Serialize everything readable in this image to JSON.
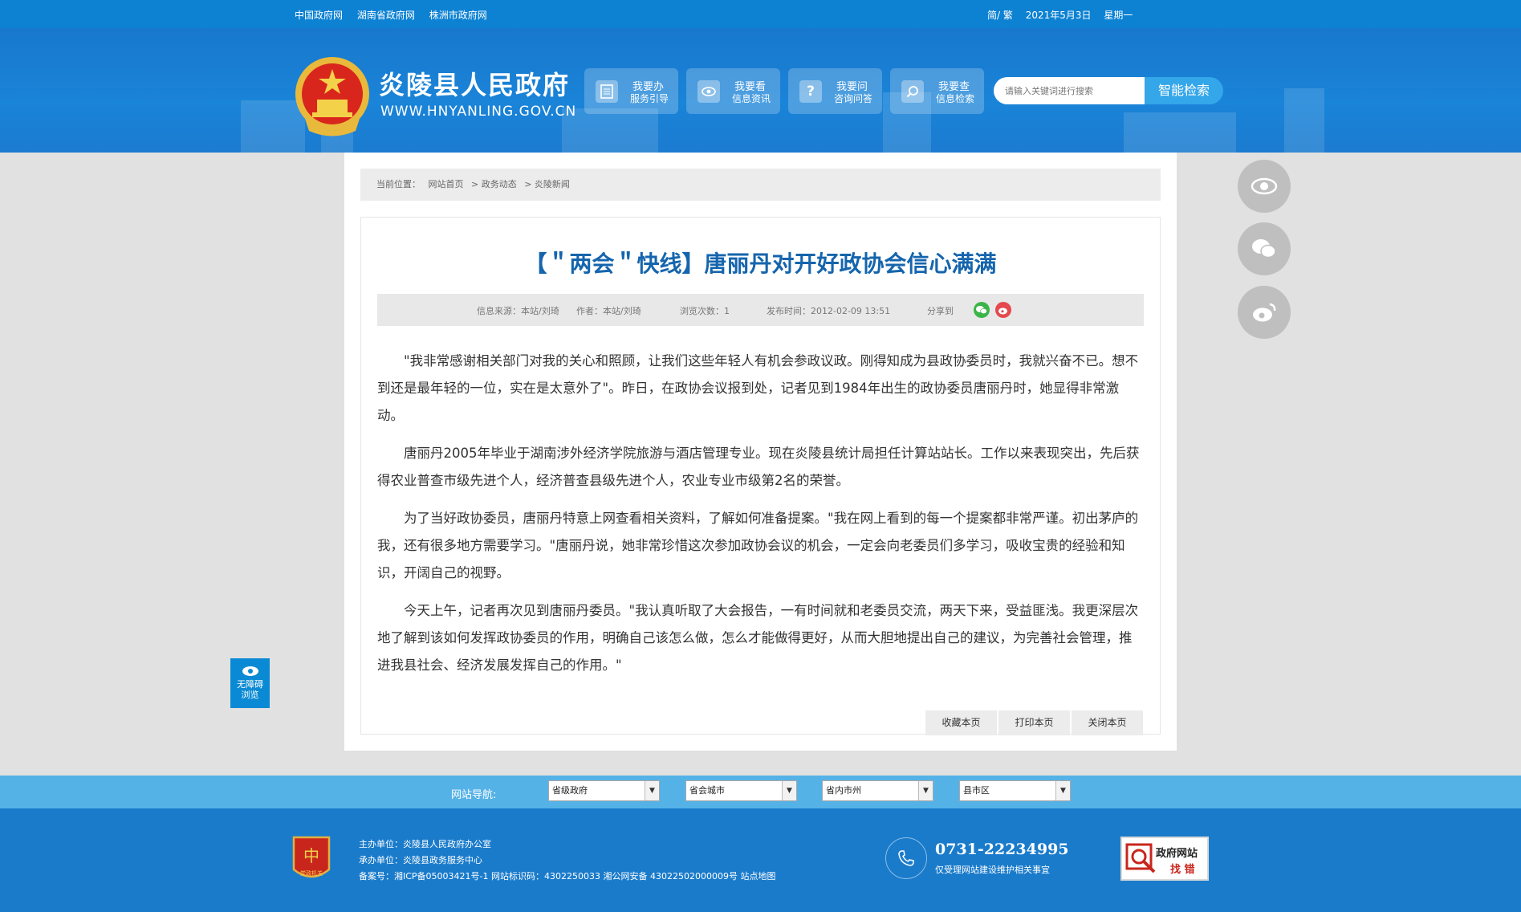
{
  "topbar": {
    "links": [
      "中国政府网",
      "湖南省政府网",
      "株洲市政府网"
    ],
    "lang": "简/ 繁",
    "date": "2021年5月3日",
    "weekday": "星期一"
  },
  "header": {
    "site_name": "炎陵县人民政府",
    "domain": "WWW.HNYANLING.GOV.CN",
    "quick_buttons": [
      {
        "line1": "我要办",
        "line2": "服务引导",
        "icon": "document-icon"
      },
      {
        "line1": "我要看",
        "line2": "信息资讯",
        "icon": "eye-icon"
      },
      {
        "line1": "我要问",
        "line2": "咨询问答",
        "icon": "question-icon"
      },
      {
        "line1": "我要查",
        "line2": "信息检索",
        "icon": "search-icon"
      }
    ],
    "search_placeholder": "请输入关键词进行搜索",
    "search_button": "智能检索"
  },
  "breadcrumb": {
    "prefix": "当前位置：",
    "items": [
      "网站首页",
      "> 政务动态",
      "> 炎陵新闻"
    ]
  },
  "article": {
    "title": "【＂两会＂快线】唐丽丹对开好政协会信心满满",
    "meta": {
      "source": "信息来源：本站/刘琦",
      "author": "作者：本站/刘琦",
      "views": "浏览次数：1",
      "published": "发布时间：2012-02-09 13:51",
      "share_label": "分享到"
    },
    "paragraphs": [
      "\"我非常感谢相关部门对我的关心和照顾，让我们这些年轻人有机会参政议政。刚得知成为县政协委员时，我就兴奋不已。想不到还是最年轻的一位，实在是太意外了\"。昨日，在政协会议报到处，记者见到1984年出生的政协委员唐丽丹时，她显得非常激动。",
      "唐丽丹2005年毕业于湖南涉外经济学院旅游与酒店管理专业。现在炎陵县统计局担任计算站站长。工作以来表现突出，先后获得农业普查市级先进个人，经济普查县级先进个人，农业专业市级第2名的荣誉。",
      "为了当好政协委员，唐丽丹特意上网查看相关资料，了解如何准备提案。\"我在网上看到的每一个提案都非常严谨。初出茅庐的我，还有很多地方需要学习。\"唐丽丹说，她非常珍惜这次参加政协会议的机会，一定会向老委员们多学习，吸收宝贵的经验和知识，开阔自己的视野。",
      "今天上午，记者再次见到唐丽丹委员。\"我认真听取了大会报告，一有时间就和老委员交流，两天下来，受益匪浅。我更深层次地了解到该如何发挥政协委员的作用，明确自己该怎么做，怎么才能做得更好，从而大胆地提出自己的建议，为完善社会管理，推进我县社会、经济发展发挥自己的作用。\""
    ],
    "actions": [
      "收藏本页",
      "打印本页",
      "关闭本页"
    ]
  },
  "accessibility": {
    "line1": "无障碍",
    "line2": "浏览"
  },
  "site_nav": {
    "label": "网站导航:",
    "selects": [
      "省级政府",
      "省会城市",
      "省内市州",
      "县市区"
    ]
  },
  "footer": {
    "sponsor": "主办单位：炎陵县人民政府办公室",
    "organizer": "承办单位：炎陵县政务服务中心",
    "record": "备案号：湘ICP备05003421号-1 网站标识码：4302250033 湘公网安备 43022502000009号 站点地图",
    "logo_text": "党政机关",
    "phone": "0731-22234995",
    "phone_note": "仅受理网站建设维护相关事宜",
    "report_line1": "政府网站",
    "report_line2": "找 错"
  },
  "colors": {
    "topbar": "#0d82d3",
    "header": "#1a84d8",
    "title": "#1565ad",
    "footer": "#1a7bcb",
    "navbar": "#55b2e7"
  }
}
